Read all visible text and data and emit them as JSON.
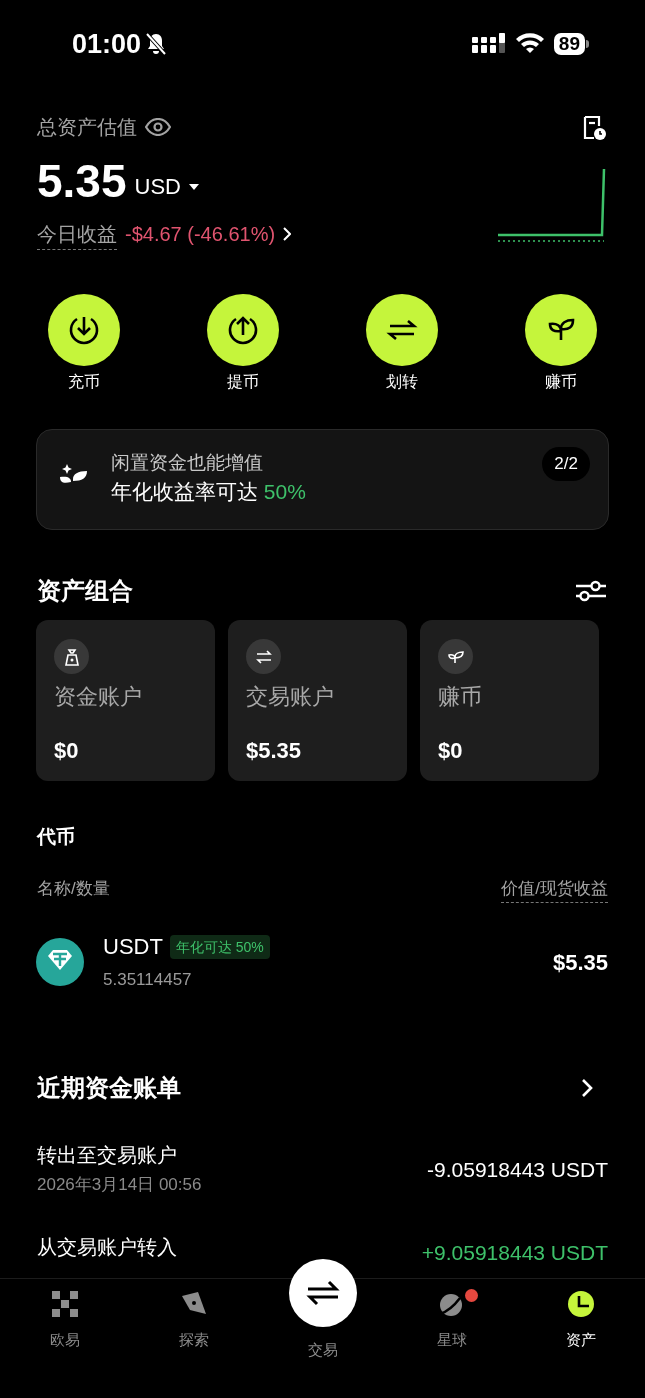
{
  "status_bar": {
    "time": "01:00",
    "silent": true,
    "battery": "89"
  },
  "overview": {
    "label": "总资产估值",
    "amount": "5.35",
    "currency": "USD",
    "today_label": "今日收益",
    "today_change": "-$4.67 (-46.61%)"
  },
  "actions": [
    {
      "label": "充币"
    },
    {
      "label": "提币"
    },
    {
      "label": "划转"
    },
    {
      "label": "赚币"
    }
  ],
  "promo": {
    "title": "闲置资金也能增值",
    "text": "年化收益率可达",
    "highlight": "50%",
    "pager": "2/2"
  },
  "portfolio": {
    "title": "资产组合",
    "accounts": [
      {
        "name": "资金账户",
        "value": "$0"
      },
      {
        "name": "交易账户",
        "value": "$5.35"
      },
      {
        "name": "赚币",
        "value": "$0"
      }
    ]
  },
  "tokens": {
    "title": "代币",
    "column_left": "名称/数量",
    "column_right": "价值/现货收益",
    "rows": [
      {
        "symbol": "USDT",
        "tag": "年化可达 50%",
        "quantity": "5.35114457",
        "value": "$5.35"
      }
    ]
  },
  "bills": {
    "title": "近期资金账单",
    "rows": [
      {
        "title": "转出至交易账户",
        "date": "2026年3月14日 00:56",
        "amount": "-9.05918443 USDT",
        "kind": "debit"
      },
      {
        "title": "从交易账户转入",
        "amount": "+9.05918443 USDT",
        "kind": "credit"
      }
    ]
  },
  "nav": [
    {
      "label": "欧易",
      "kind": "tab",
      "selected": false,
      "badge": false
    },
    {
      "label": "探索",
      "kind": "tab",
      "selected": false,
      "badge": false
    },
    {
      "label": "交易",
      "kind": "center",
      "selected": false,
      "badge": false
    },
    {
      "label": "星球",
      "kind": "tab",
      "selected": false,
      "badge": true
    },
    {
      "label": "资产",
      "kind": "tab",
      "selected": true,
      "badge": false
    }
  ]
}
